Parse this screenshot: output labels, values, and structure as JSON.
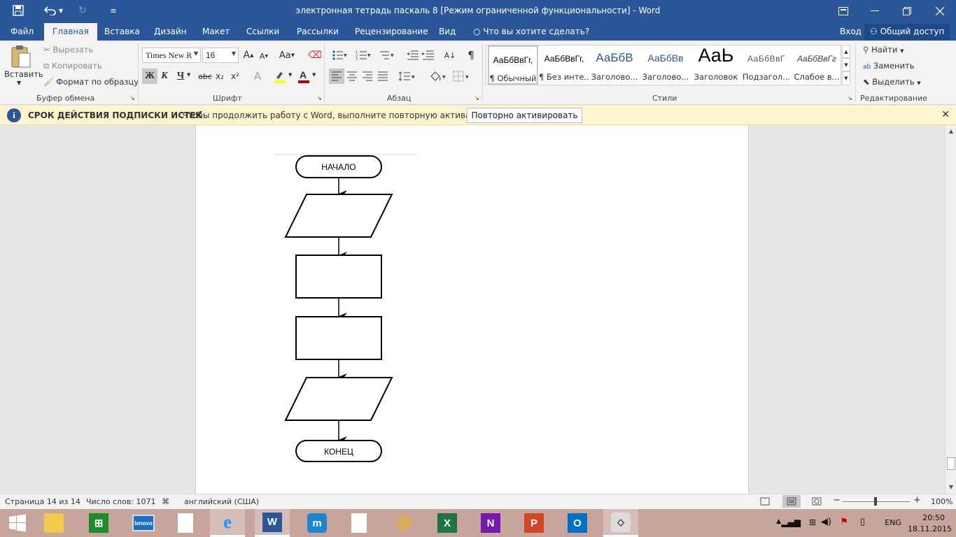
{
  "window": {
    "title": "электронная тетрадь паскаль 8 [Режим ограниченной функциональности] - Word"
  },
  "tabs": [
    "Файл",
    "Главная",
    "Вставка",
    "Дизайн",
    "Макет",
    "Ссылки",
    "Рассылки",
    "Рецензирование",
    "Вид"
  ],
  "active_tab": "Главная",
  "tell_me": "Что вы хотите сделать?",
  "signin": "Вход",
  "share": "Общий доступ",
  "clipboard": {
    "paste": "Вставить",
    "cut": "Вырезать",
    "copy": "Копировать",
    "format_painter": "Формат по образцу",
    "label": "Буфер обмена"
  },
  "font": {
    "name": "Times New R",
    "size": "16",
    "bold": "Ж",
    "italic": "К",
    "underline": "Ч",
    "strike": "abc",
    "subscript": "x₂",
    "superscript": "x²",
    "grow": "A",
    "shrink": "A",
    "case": "Aa",
    "label": "Шрифт"
  },
  "paragraph": {
    "label": "Абзац"
  },
  "styles": {
    "label": "Стили",
    "items": [
      {
        "sample": "АаБбВвГг,",
        "name": "¶ Обычный"
      },
      {
        "sample": "АаБбВвГг,",
        "name": "¶ Без инте..."
      },
      {
        "sample": "АаБбВ",
        "name": "Заголово..."
      },
      {
        "sample": "АаБбВв",
        "name": "Заголово..."
      },
      {
        "sample": "АаЬ",
        "name": "Заголовок"
      },
      {
        "sample": "АаБбВвГ",
        "name": "Подзагол..."
      },
      {
        "sample": "АаБбВвГг",
        "name": "Слабое в..."
      }
    ]
  },
  "editing": {
    "find": "Найти",
    "replace": "Заменить",
    "select": "Выделить",
    "label": "Редактирование"
  },
  "message_bar": {
    "heading": "СРОК ДЕЙСТВИЯ ПОДПИСКИ ИСТЕК",
    "text": "Чтобы продолжить работу с Word, выполните повторную активацию.",
    "button": "Повторно активировать"
  },
  "flowchart": {
    "start": "НАЧАЛО",
    "end": "КОНЕЦ"
  },
  "statusbar": {
    "page": "Страница 14 из 14",
    "words": "Число слов: 1071",
    "language": "английский (США)",
    "zoom": "100%"
  },
  "taskbar": {
    "lang": "ENG",
    "time": "20:50",
    "date": "18.11.2015"
  },
  "colors": {
    "accent": "#2b579a",
    "message_bar": "#fff4ce",
    "taskbar": "#c7a49c"
  }
}
